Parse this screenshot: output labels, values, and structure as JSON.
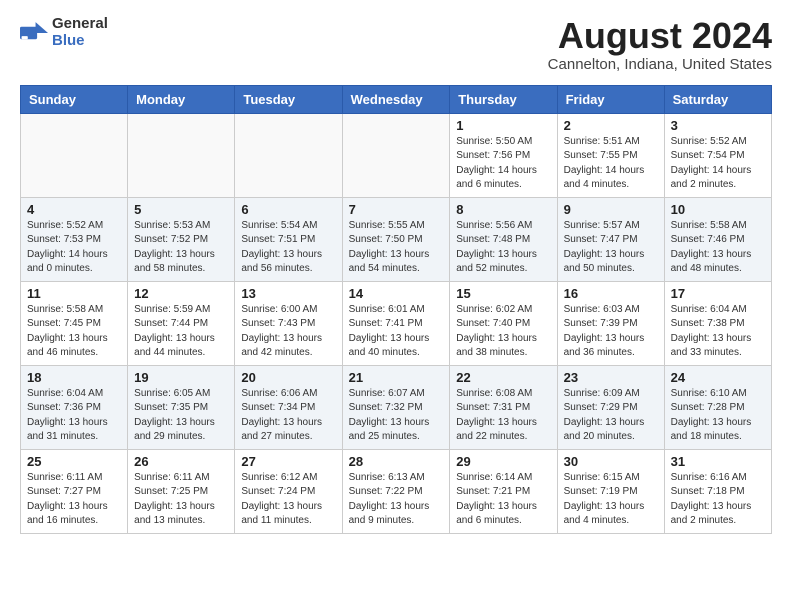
{
  "logo": {
    "text_general": "General",
    "text_blue": "Blue"
  },
  "title": "August 2024",
  "subtitle": "Cannelton, Indiana, United States",
  "days_of_week": [
    "Sunday",
    "Monday",
    "Tuesday",
    "Wednesday",
    "Thursday",
    "Friday",
    "Saturday"
  ],
  "weeks": [
    [
      {
        "day": "",
        "info": ""
      },
      {
        "day": "",
        "info": ""
      },
      {
        "day": "",
        "info": ""
      },
      {
        "day": "",
        "info": ""
      },
      {
        "day": "1",
        "info": "Sunrise: 5:50 AM\nSunset: 7:56 PM\nDaylight: 14 hours\nand 6 minutes."
      },
      {
        "day": "2",
        "info": "Sunrise: 5:51 AM\nSunset: 7:55 PM\nDaylight: 14 hours\nand 4 minutes."
      },
      {
        "day": "3",
        "info": "Sunrise: 5:52 AM\nSunset: 7:54 PM\nDaylight: 14 hours\nand 2 minutes."
      }
    ],
    [
      {
        "day": "4",
        "info": "Sunrise: 5:52 AM\nSunset: 7:53 PM\nDaylight: 14 hours\nand 0 minutes."
      },
      {
        "day": "5",
        "info": "Sunrise: 5:53 AM\nSunset: 7:52 PM\nDaylight: 13 hours\nand 58 minutes."
      },
      {
        "day": "6",
        "info": "Sunrise: 5:54 AM\nSunset: 7:51 PM\nDaylight: 13 hours\nand 56 minutes."
      },
      {
        "day": "7",
        "info": "Sunrise: 5:55 AM\nSunset: 7:50 PM\nDaylight: 13 hours\nand 54 minutes."
      },
      {
        "day": "8",
        "info": "Sunrise: 5:56 AM\nSunset: 7:48 PM\nDaylight: 13 hours\nand 52 minutes."
      },
      {
        "day": "9",
        "info": "Sunrise: 5:57 AM\nSunset: 7:47 PM\nDaylight: 13 hours\nand 50 minutes."
      },
      {
        "day": "10",
        "info": "Sunrise: 5:58 AM\nSunset: 7:46 PM\nDaylight: 13 hours\nand 48 minutes."
      }
    ],
    [
      {
        "day": "11",
        "info": "Sunrise: 5:58 AM\nSunset: 7:45 PM\nDaylight: 13 hours\nand 46 minutes."
      },
      {
        "day": "12",
        "info": "Sunrise: 5:59 AM\nSunset: 7:44 PM\nDaylight: 13 hours\nand 44 minutes."
      },
      {
        "day": "13",
        "info": "Sunrise: 6:00 AM\nSunset: 7:43 PM\nDaylight: 13 hours\nand 42 minutes."
      },
      {
        "day": "14",
        "info": "Sunrise: 6:01 AM\nSunset: 7:41 PM\nDaylight: 13 hours\nand 40 minutes."
      },
      {
        "day": "15",
        "info": "Sunrise: 6:02 AM\nSunset: 7:40 PM\nDaylight: 13 hours\nand 38 minutes."
      },
      {
        "day": "16",
        "info": "Sunrise: 6:03 AM\nSunset: 7:39 PM\nDaylight: 13 hours\nand 36 minutes."
      },
      {
        "day": "17",
        "info": "Sunrise: 6:04 AM\nSunset: 7:38 PM\nDaylight: 13 hours\nand 33 minutes."
      }
    ],
    [
      {
        "day": "18",
        "info": "Sunrise: 6:04 AM\nSunset: 7:36 PM\nDaylight: 13 hours\nand 31 minutes."
      },
      {
        "day": "19",
        "info": "Sunrise: 6:05 AM\nSunset: 7:35 PM\nDaylight: 13 hours\nand 29 minutes."
      },
      {
        "day": "20",
        "info": "Sunrise: 6:06 AM\nSunset: 7:34 PM\nDaylight: 13 hours\nand 27 minutes."
      },
      {
        "day": "21",
        "info": "Sunrise: 6:07 AM\nSunset: 7:32 PM\nDaylight: 13 hours\nand 25 minutes."
      },
      {
        "day": "22",
        "info": "Sunrise: 6:08 AM\nSunset: 7:31 PM\nDaylight: 13 hours\nand 22 minutes."
      },
      {
        "day": "23",
        "info": "Sunrise: 6:09 AM\nSunset: 7:29 PM\nDaylight: 13 hours\nand 20 minutes."
      },
      {
        "day": "24",
        "info": "Sunrise: 6:10 AM\nSunset: 7:28 PM\nDaylight: 13 hours\nand 18 minutes."
      }
    ],
    [
      {
        "day": "25",
        "info": "Sunrise: 6:11 AM\nSunset: 7:27 PM\nDaylight: 13 hours\nand 16 minutes."
      },
      {
        "day": "26",
        "info": "Sunrise: 6:11 AM\nSunset: 7:25 PM\nDaylight: 13 hours\nand 13 minutes."
      },
      {
        "day": "27",
        "info": "Sunrise: 6:12 AM\nSunset: 7:24 PM\nDaylight: 13 hours\nand 11 minutes."
      },
      {
        "day": "28",
        "info": "Sunrise: 6:13 AM\nSunset: 7:22 PM\nDaylight: 13 hours\nand 9 minutes."
      },
      {
        "day": "29",
        "info": "Sunrise: 6:14 AM\nSunset: 7:21 PM\nDaylight: 13 hours\nand 6 minutes."
      },
      {
        "day": "30",
        "info": "Sunrise: 6:15 AM\nSunset: 7:19 PM\nDaylight: 13 hours\nand 4 minutes."
      },
      {
        "day": "31",
        "info": "Sunrise: 6:16 AM\nSunset: 7:18 PM\nDaylight: 13 hours\nand 2 minutes."
      }
    ]
  ]
}
